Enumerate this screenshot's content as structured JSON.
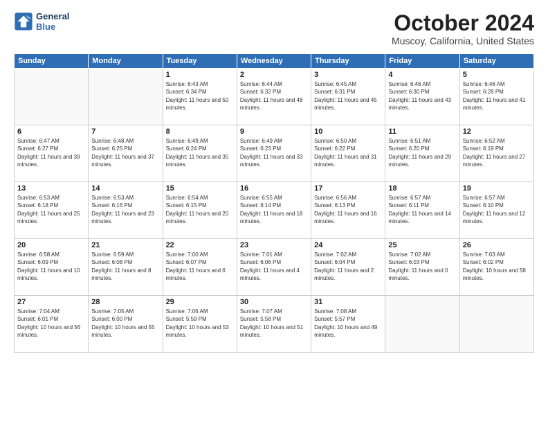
{
  "logo": {
    "line1": "General",
    "line2": "Blue"
  },
  "title": "October 2024",
  "location": "Muscoy, California, United States",
  "days_of_week": [
    "Sunday",
    "Monday",
    "Tuesday",
    "Wednesday",
    "Thursday",
    "Friday",
    "Saturday"
  ],
  "weeks": [
    [
      {
        "day": "",
        "info": ""
      },
      {
        "day": "",
        "info": ""
      },
      {
        "day": "1",
        "info": "Sunrise: 6:43 AM\nSunset: 6:34 PM\nDaylight: 11 hours and 50 minutes."
      },
      {
        "day": "2",
        "info": "Sunrise: 6:44 AM\nSunset: 6:32 PM\nDaylight: 11 hours and 48 minutes."
      },
      {
        "day": "3",
        "info": "Sunrise: 6:45 AM\nSunset: 6:31 PM\nDaylight: 11 hours and 45 minutes."
      },
      {
        "day": "4",
        "info": "Sunrise: 6:46 AM\nSunset: 6:30 PM\nDaylight: 11 hours and 43 minutes."
      },
      {
        "day": "5",
        "info": "Sunrise: 6:46 AM\nSunset: 6:28 PM\nDaylight: 11 hours and 41 minutes."
      }
    ],
    [
      {
        "day": "6",
        "info": "Sunrise: 6:47 AM\nSunset: 6:27 PM\nDaylight: 11 hours and 39 minutes."
      },
      {
        "day": "7",
        "info": "Sunrise: 6:48 AM\nSunset: 6:25 PM\nDaylight: 11 hours and 37 minutes."
      },
      {
        "day": "8",
        "info": "Sunrise: 6:49 AM\nSunset: 6:24 PM\nDaylight: 11 hours and 35 minutes."
      },
      {
        "day": "9",
        "info": "Sunrise: 6:49 AM\nSunset: 6:23 PM\nDaylight: 11 hours and 33 minutes."
      },
      {
        "day": "10",
        "info": "Sunrise: 6:50 AM\nSunset: 6:22 PM\nDaylight: 11 hours and 31 minutes."
      },
      {
        "day": "11",
        "info": "Sunrise: 6:51 AM\nSunset: 6:20 PM\nDaylight: 11 hours and 29 minutes."
      },
      {
        "day": "12",
        "info": "Sunrise: 6:52 AM\nSunset: 6:19 PM\nDaylight: 11 hours and 27 minutes."
      }
    ],
    [
      {
        "day": "13",
        "info": "Sunrise: 6:53 AM\nSunset: 6:18 PM\nDaylight: 11 hours and 25 minutes."
      },
      {
        "day": "14",
        "info": "Sunrise: 6:53 AM\nSunset: 6:16 PM\nDaylight: 11 hours and 23 minutes."
      },
      {
        "day": "15",
        "info": "Sunrise: 6:54 AM\nSunset: 6:15 PM\nDaylight: 11 hours and 20 minutes."
      },
      {
        "day": "16",
        "info": "Sunrise: 6:55 AM\nSunset: 6:14 PM\nDaylight: 11 hours and 18 minutes."
      },
      {
        "day": "17",
        "info": "Sunrise: 6:56 AM\nSunset: 6:13 PM\nDaylight: 11 hours and 16 minutes."
      },
      {
        "day": "18",
        "info": "Sunrise: 6:57 AM\nSunset: 6:11 PM\nDaylight: 11 hours and 14 minutes."
      },
      {
        "day": "19",
        "info": "Sunrise: 6:57 AM\nSunset: 6:10 PM\nDaylight: 11 hours and 12 minutes."
      }
    ],
    [
      {
        "day": "20",
        "info": "Sunrise: 6:58 AM\nSunset: 6:09 PM\nDaylight: 11 hours and 10 minutes."
      },
      {
        "day": "21",
        "info": "Sunrise: 6:59 AM\nSunset: 6:08 PM\nDaylight: 11 hours and 8 minutes."
      },
      {
        "day": "22",
        "info": "Sunrise: 7:00 AM\nSunset: 6:07 PM\nDaylight: 11 hours and 6 minutes."
      },
      {
        "day": "23",
        "info": "Sunrise: 7:01 AM\nSunset: 6:06 PM\nDaylight: 11 hours and 4 minutes."
      },
      {
        "day": "24",
        "info": "Sunrise: 7:02 AM\nSunset: 6:04 PM\nDaylight: 11 hours and 2 minutes."
      },
      {
        "day": "25",
        "info": "Sunrise: 7:02 AM\nSunset: 6:03 PM\nDaylight: 11 hours and 0 minutes."
      },
      {
        "day": "26",
        "info": "Sunrise: 7:03 AM\nSunset: 6:02 PM\nDaylight: 10 hours and 58 minutes."
      }
    ],
    [
      {
        "day": "27",
        "info": "Sunrise: 7:04 AM\nSunset: 6:01 PM\nDaylight: 10 hours and 56 minutes."
      },
      {
        "day": "28",
        "info": "Sunrise: 7:05 AM\nSunset: 6:00 PM\nDaylight: 10 hours and 55 minutes."
      },
      {
        "day": "29",
        "info": "Sunrise: 7:06 AM\nSunset: 5:59 PM\nDaylight: 10 hours and 53 minutes."
      },
      {
        "day": "30",
        "info": "Sunrise: 7:07 AM\nSunset: 5:58 PM\nDaylight: 10 hours and 51 minutes."
      },
      {
        "day": "31",
        "info": "Sunrise: 7:08 AM\nSunset: 5:57 PM\nDaylight: 10 hours and 49 minutes."
      },
      {
        "day": "",
        "info": ""
      },
      {
        "day": "",
        "info": ""
      }
    ]
  ]
}
